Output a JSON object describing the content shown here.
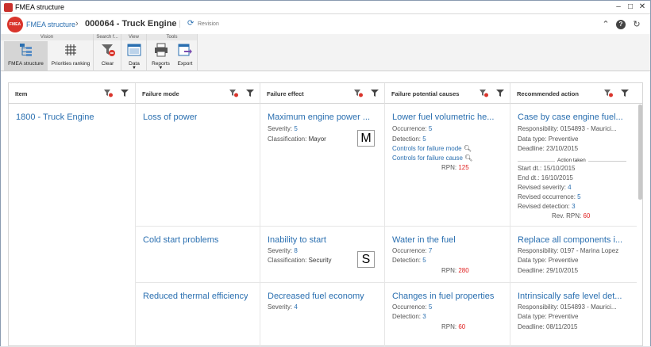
{
  "window": {
    "title": "FMEA structure"
  },
  "header": {
    "breadcrumb1": "FMEA structure",
    "breadcrumb_sep": "›",
    "record": "000064 - Truck Engine",
    "revision": "Revision",
    "logo": "FMEA"
  },
  "ribbon": {
    "groups": [
      "Vision",
      "Search f...",
      "View",
      "Tools"
    ],
    "buttons": {
      "fmea": "FMEA structure",
      "priorities": "Priorities ranking",
      "clear": "Clear",
      "data": "Data",
      "reports": "Reports",
      "export": "Export"
    }
  },
  "columns": [
    "Item",
    "Failure mode",
    "Failure effect",
    "Failure potential causes",
    "Recommended action"
  ],
  "item": "1800 - Truck Engine",
  "rows": [
    {
      "mode": "Loss of power",
      "effect": {
        "title": "Maximum engine power ...",
        "severity_label": "Severity:",
        "severity": "5",
        "class_label": "Classification:",
        "classification": "Mayor",
        "badge": "M"
      },
      "cause": {
        "title": "Lower fuel volumetric he...",
        "occ_label": "Occurrence:",
        "occurrence": "5",
        "det_label": "Detection:",
        "detection": "5",
        "ctrl_mode": "Controls for failure mode",
        "ctrl_cause": "Controls for failure cause",
        "rpn_label": "RPN:",
        "rpn": "125"
      },
      "action": {
        "title": "Case by case engine fuel...",
        "resp_label": "Responsibility:",
        "resp": "0154893 - Maurici...",
        "dtype_label": "Data type:",
        "dtype": "Preventive",
        "dead_label": "Deadline:",
        "deadline": "23/10/2015",
        "taken": "Action taken",
        "start": "Start dt.: 15/10/2015",
        "end": "End dt.: 16/10/2015",
        "rsev_label": "Revised severity:",
        "rsev": "4",
        "rocc_label": "Revised occurrence:",
        "rocc": "5",
        "rdet_label": "Revised detection:",
        "rdet": "3",
        "rrpn_label": "Rev. RPN:",
        "rrpn": "60"
      }
    },
    {
      "mode": "Cold start problems",
      "effect": {
        "title": "Inability to start",
        "severity_label": "Severity:",
        "severity": "8",
        "class_label": "Classification:",
        "classification": "Security",
        "badge": "S"
      },
      "cause": {
        "title": "Water in the fuel",
        "occ_label": "Occurrence:",
        "occurrence": "7",
        "det_label": "Detection:",
        "detection": "5",
        "rpn_label": "RPN:",
        "rpn": "280"
      },
      "action": {
        "title": "Replace all components i...",
        "resp_label": "Responsibility:",
        "resp": "0197 - Marina Lopez",
        "dtype_label": "Data type:",
        "dtype": "Preventive",
        "dead_label": "Deadline:",
        "deadline": "29/10/2015"
      }
    },
    {
      "mode": "Reduced thermal efficiency",
      "effect": {
        "title": "Decreased fuel economy",
        "severity_label": "Severity:",
        "severity": "4"
      },
      "cause": {
        "title": "Changes in fuel properties",
        "occ_label": "Occurrence:",
        "occurrence": "5",
        "det_label": "Detection:",
        "detection": "3",
        "rpn_label": "RPN:",
        "rpn": "60"
      },
      "action": {
        "title": "Intrinsically safe level det...",
        "resp_label": "Responsibility:",
        "resp": "0154893 - Maurici...",
        "dtype_label": "Data type:",
        "dtype": "Preventive",
        "dead_label": "Deadline:",
        "deadline": "08/11/2015"
      }
    }
  ]
}
